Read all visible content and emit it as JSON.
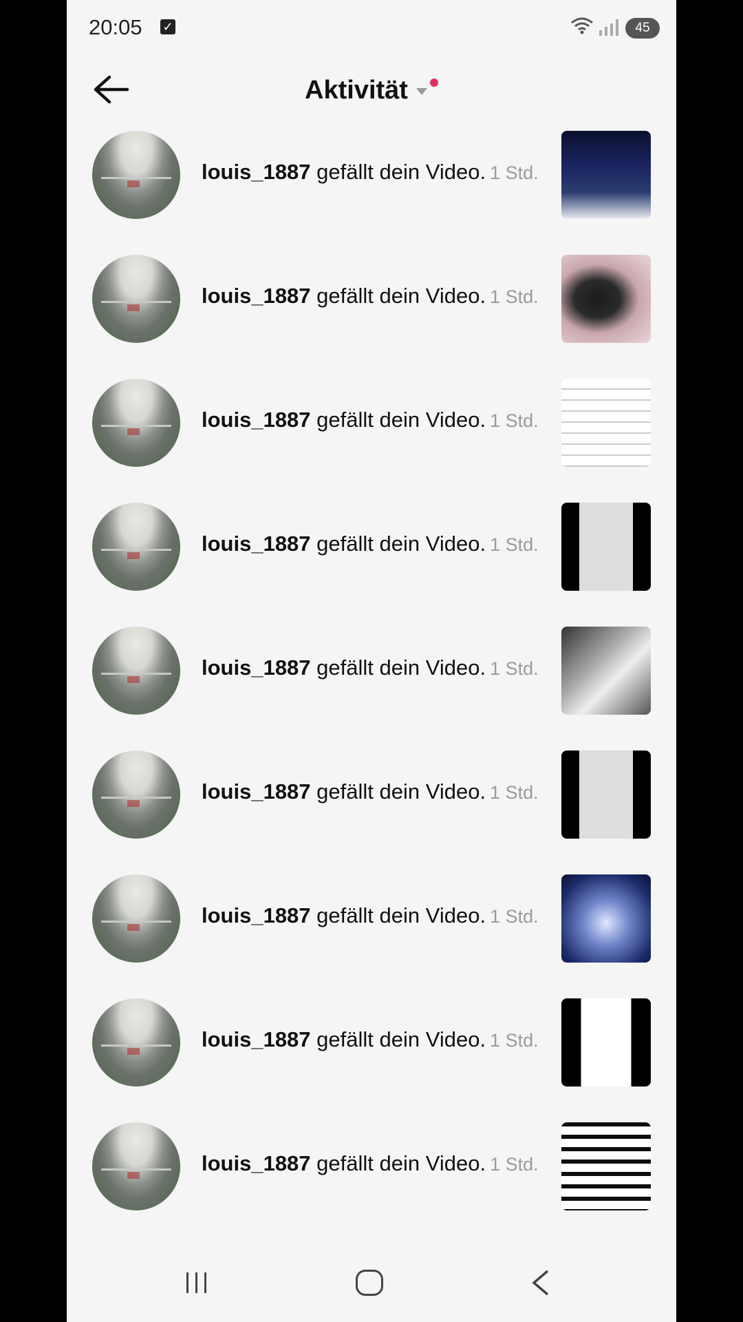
{
  "status_bar": {
    "time": "20:05",
    "battery": "45"
  },
  "header": {
    "title": "Aktivität"
  },
  "notifications": [
    {
      "user": "louis_1887",
      "action": "gefällt dein Video.",
      "time": "1 Std.",
      "thumb": "t-football"
    },
    {
      "user": "louis_1887",
      "action": "gefällt dein Video.",
      "time": "1 Std.",
      "thumb": "t-cat"
    },
    {
      "user": "louis_1887",
      "action": "gefällt dein Video.",
      "time": "1 Std.",
      "thumb": "t-list"
    },
    {
      "user": "louis_1887",
      "action": "gefällt dein Video.",
      "time": "1 Std.",
      "thumb": "t-dark"
    },
    {
      "user": "louis_1887",
      "action": "gefällt dein Video.",
      "time": "1 Std.",
      "thumb": "t-dark2"
    },
    {
      "user": "louis_1887",
      "action": "gefällt dein Video.",
      "time": "1 Std.",
      "thumb": "t-dark"
    },
    {
      "user": "louis_1887",
      "action": "gefällt dein Video.",
      "time": "1 Std.",
      "thumb": "t-poster"
    },
    {
      "user": "louis_1887",
      "action": "gefällt dein Video.",
      "time": "1 Std.",
      "thumb": "t-list2"
    },
    {
      "user": "louis_1887",
      "action": "gefällt dein Video.",
      "time": "1 Std.",
      "thumb": "t-list3"
    }
  ]
}
